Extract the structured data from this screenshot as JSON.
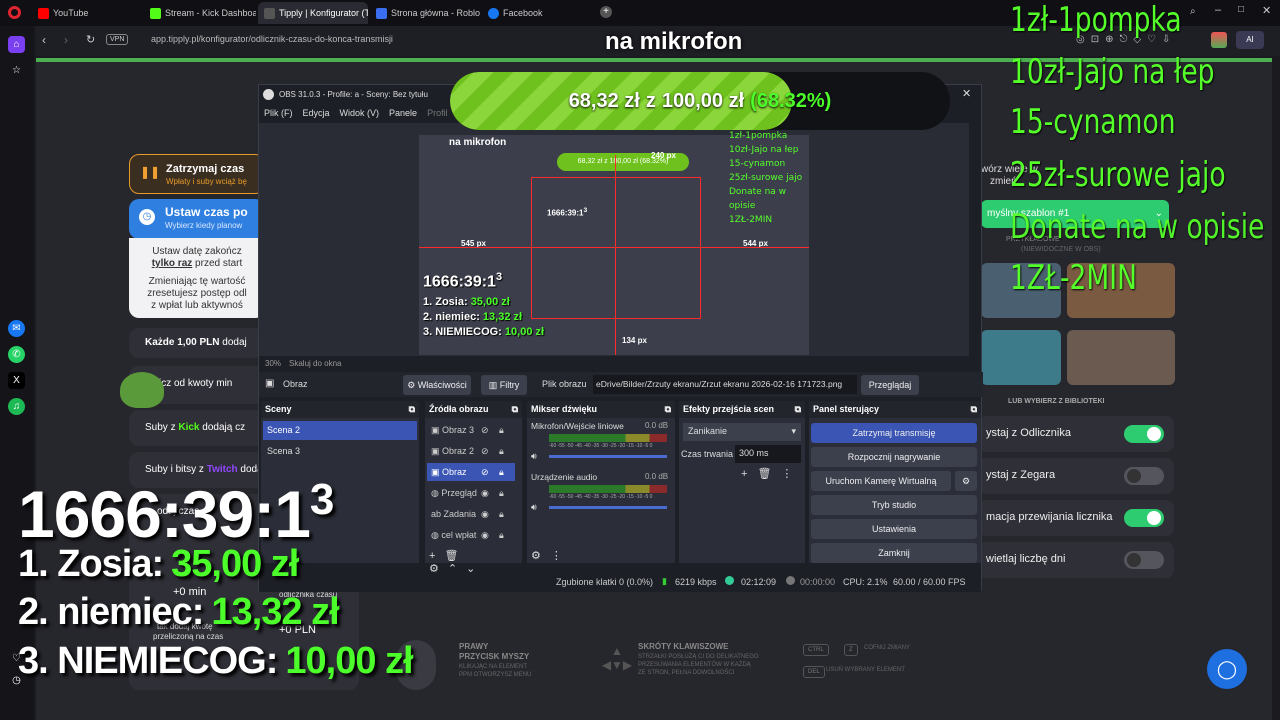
{
  "tabs": [
    {
      "label": "YouTube",
      "color": "#ff0000"
    },
    {
      "label": "Stream - Kick Dashboard",
      "color": "#53fc18"
    },
    {
      "label": "Tipply | Konfigurator (Tw",
      "color": "#444"
    },
    {
      "label": "Strona główna - Roblox",
      "color": "#3a6df0"
    },
    {
      "label": "Facebook",
      "color": "#1877f2"
    }
  ],
  "address": {
    "vpn": "VPN",
    "url": "app.tipply.pl/konfigurator/odlicznik-czasu-do-konca-transmisji"
  },
  "overlay": {
    "mic_text": "na mikrofon",
    "progress": {
      "current": "68,32 zł",
      "sep": "z",
      "goal": "100,00 zł",
      "percent_text": "(68.32%)",
      "fraction": 0.6832
    },
    "price_list": [
      "1zł-1pompka",
      "10zł-Jajo na łep",
      "15-cynamon",
      "25zł-surowe jajo",
      "Donate na w opisie",
      "1ZŁ-2MIN"
    ],
    "timer_main": "1666:39:1",
    "timer_sup": "3",
    "donors": [
      {
        "name": "1. Zosia:",
        "amount": "35,00 zł"
      },
      {
        "name": "2. niemiec:",
        "amount": "13,32 zł"
      },
      {
        "name": "3. NIEMIECOG:",
        "amount": "10,00 zł"
      }
    ]
  },
  "tipply": {
    "pause_title": "Zatrzymaj czas",
    "pause_sub": "Wpłaty i suby wciąż bę",
    "set_title": "Ustaw czas po",
    "set_sub": "Wybierz kiedy planow",
    "info1a": "Ustaw datę zakończ",
    "info1b": "tylko raz",
    "info1c": "przed start",
    "info2a": "Zmieniając tę wartość",
    "info2b": "zresetujesz postęp odl",
    "info2c": "z wpłat lub aktywnoś",
    "each_pln": "Każde 1,00 PLN",
    "each_pln_rest": "dodaj",
    "from_amount": "icz od kwoty min",
    "kick_subs_a": "Suby z",
    "kick_subs_b": "Kick",
    "kick_subs_c": "dodają cz",
    "twitch_subs_a": "Suby i bitsy z",
    "twitch_subs_b": "Twitch",
    "twitch_subs_c": "dodaj",
    "add_time": "odaj czas",
    "zero_min": "+0 min",
    "fixed_line1": "tak dodaj kwotę",
    "fixed_line2": "przeliczoną na czas",
    "zero_pln": "+0 PLN",
    "odlicznik_czasu": "odlicznika czasu",
    "right_header_1": "wórz wiele w",
    "right_header_2": "zmień",
    "default_btn": "myślny szablon #1",
    "przykladowe": "PRZYKŁADOWE",
    "niewidoczne": "(NIEWIDOCZNE W OBS)",
    "library": "LUB WYBIERZ Z BIBLIOTEKI",
    "settings": [
      {
        "label": "ystaj z Odlicznika",
        "on": true
      },
      {
        "label": "ystaj z Zegara",
        "on": false
      },
      {
        "label": "macja przewijania licznika",
        "on": true
      },
      {
        "label": "wietlaj liczbę dni",
        "on": false
      }
    ],
    "help": {
      "mouse_title1": "PRAWY",
      "mouse_title2": "PRZYCISK MYSZY",
      "mouse_sub1": "KLIKAJĄC NA ELEMENT",
      "mouse_sub2": "PPM OTWORZYSZ MENU",
      "keys_title": "SKRÓTY KLAWISZOWE",
      "keys_sub1": "STRZAŁKI POSŁUŻĄ CI DO DELIKATNEGO",
      "keys_sub2": "PRZESUWANIA ELEMENTÓW W KAŻDĄ",
      "keys_sub3": "ZE STRON, PEŁNA DOWOLNOŚCI",
      "undo": "COFNIJ ZMIANY",
      "delete": "USUŃ WYBRANY ELEMENT",
      "ctrl": "CTRL",
      "z": "Z",
      "del": "DEL"
    }
  },
  "obs": {
    "title": "OBS 31.0.3 - Profile: a - Sceny: Bez tytułu",
    "menu": [
      "Plik (F)",
      "Edycja",
      "Widok (V)",
      "Panele",
      "Profil"
    ],
    "preview": {
      "zoom": "30%",
      "zoom_mode": "Skaluj do okna",
      "px_top": "240 px",
      "px_left": "545 px",
      "px_right": "544 px",
      "px_bottom": "134 px",
      "nested_mic": "na mikrofon",
      "nested_progress": "68,32 zł z 100,00 zł (68.32%)",
      "nested_timer": "1666:39:1",
      "nested_timer_sup": "3",
      "nested_donors": [
        {
          "name": "1. Zosia:",
          "amount": "35,00 zł"
        },
        {
          "name": "2. niemiec:",
          "amount": "13,32 zł"
        },
        {
          "name": "3. NIEMIECOG:",
          "amount": "10,00 zł"
        }
      ],
      "nested_prices": [
        "1zł-1pompka",
        "10zł-Jajo na łep",
        "15-cynamon",
        "25zł-surowe jajo",
        "Donate na w opisie",
        "1ZŁ-2MIN"
      ]
    },
    "source_bar": {
      "selected": "Obraz",
      "properties": "Właściwości",
      "filters": "Filtry",
      "image_label": "Plik obrazu",
      "image_path": "eDrive/Bilder/Zrzuty ekranu/Zrzut ekranu 2026-02-16 171723.png",
      "browse": "Przeglądaj"
    },
    "scenes": {
      "title": "Sceny",
      "items": [
        "Scena 2",
        "Scena 3"
      ]
    },
    "sources": {
      "title": "Źródła obrazu",
      "items": [
        "Obraz 3",
        "Obraz 2",
        "Obraz",
        "Przegląd",
        "Zadania",
        "cel wpłat"
      ]
    },
    "mixer": {
      "title": "Mikser dźwięku",
      "channels": [
        {
          "name": "Mikrofon/Wejście liniowe",
          "db": "0.0 dB"
        },
        {
          "name": "Urządzenie audio",
          "db": "0.0 dB"
        }
      ],
      "scale": "-60 -55 -50 -45 -40 -35 -30 -25 -20 -15 -10 -5 0"
    },
    "transitions": {
      "title": "Efekty przejścia scen",
      "type": "Zanikanie",
      "duration_label": "Czas trwania",
      "duration": "300 ms"
    },
    "controls": {
      "title": "Panel sterujący",
      "buttons": [
        "Zatrzymaj transmisję",
        "Rozpocznij nagrywanie",
        "Uruchom Kamerę Wirtualną",
        "Tryb studio",
        "Ustawienia",
        "Zamknij"
      ]
    },
    "status": {
      "dropped": "Zgubione klatki 0 (0.0%)",
      "bitrate": "6219 kbps",
      "stream_time": "02:12:09",
      "rec_time": "00:00:00",
      "cpu": "CPU: 2.1%",
      "fps": "60.00 / 60.00 FPS"
    }
  }
}
